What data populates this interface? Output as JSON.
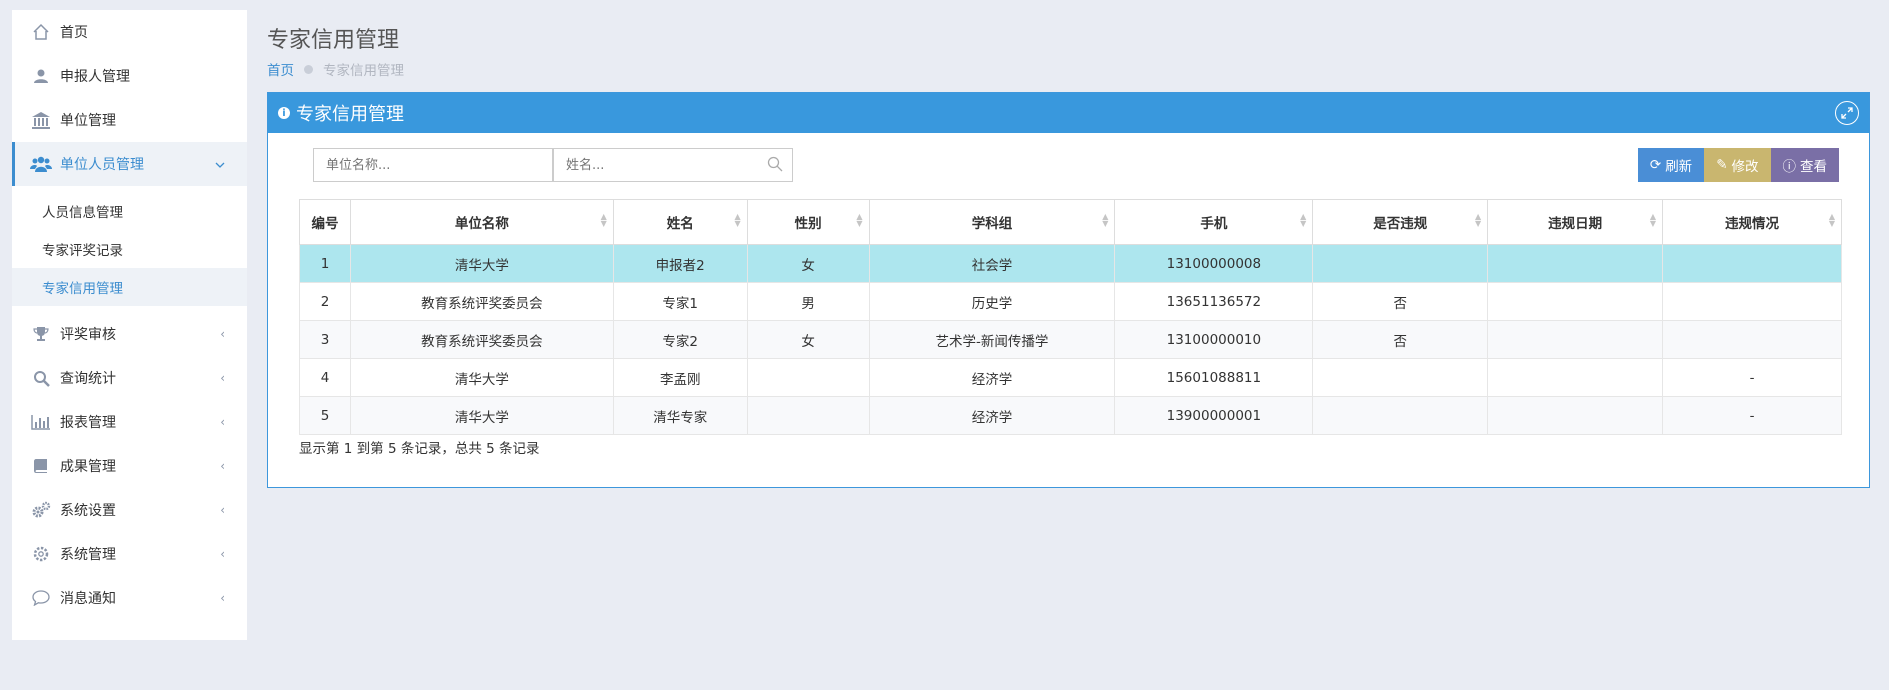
{
  "sidebar": {
    "items": [
      {
        "label": "首页",
        "icon": "home-icon"
      },
      {
        "label": "申报人管理",
        "icon": "user-icon"
      },
      {
        "label": "单位管理",
        "icon": "bank-icon"
      },
      {
        "label": "单位人员管理",
        "icon": "users-icon",
        "expanded": true
      },
      {
        "label": "评奖审核",
        "icon": "trophy-icon"
      },
      {
        "label": "查询统计",
        "icon": "search-icon"
      },
      {
        "label": "报表管理",
        "icon": "bar-chart-icon"
      },
      {
        "label": "成果管理",
        "icon": "book-icon"
      },
      {
        "label": "系统设置",
        "icon": "gears-icon"
      },
      {
        "label": "系统管理",
        "icon": "gear-icon"
      },
      {
        "label": "消息通知",
        "icon": "comment-icon"
      }
    ],
    "subitems": [
      {
        "label": "人员信息管理"
      },
      {
        "label": "专家评奖记录"
      },
      {
        "label": "专家信用管理"
      }
    ]
  },
  "page": {
    "title": "专家信用管理",
    "breadcrumb_home": "首页",
    "breadcrumb_current": "专家信用管理"
  },
  "panel": {
    "title": "专家信用管理",
    "search_unit_placeholder": "单位名称...",
    "search_name_placeholder": "姓名...",
    "btn_refresh": "刷新",
    "btn_edit": "修改",
    "btn_view": "查看"
  },
  "table": {
    "headers": [
      "编号",
      "单位名称",
      "姓名",
      "性别",
      "学科组",
      "手机",
      "是否违规",
      "违规日期",
      "违规情况"
    ],
    "rows": [
      [
        "1",
        "清华大学",
        "申报者2",
        "女",
        "社会学",
        "13100000008",
        "",
        "",
        ""
      ],
      [
        "2",
        "教育系统评奖委员会",
        "专家1",
        "男",
        "历史学",
        "13651136572",
        "否",
        "",
        ""
      ],
      [
        "3",
        "教育系统评奖委员会",
        "专家2",
        "女",
        "艺术学-新闻传播学",
        "13100000010",
        "否",
        "",
        ""
      ],
      [
        "4",
        "清华大学",
        "李孟刚",
        "",
        "经济学",
        "15601088811",
        "",
        "",
        "-"
      ],
      [
        "5",
        "清华大学",
        "清华专家",
        "",
        "经济学",
        "13900000001",
        "",
        "",
        "-"
      ]
    ],
    "summary": "显示第 1 到第 5 条记录，总共 5 条记录"
  },
  "colors": {
    "accent": "#3998dd",
    "selected_row": "#ade6ee",
    "btn_refresh": "#4a8ed6",
    "btn_edit": "#c9b66f",
    "btn_view": "#7a6fa6"
  }
}
